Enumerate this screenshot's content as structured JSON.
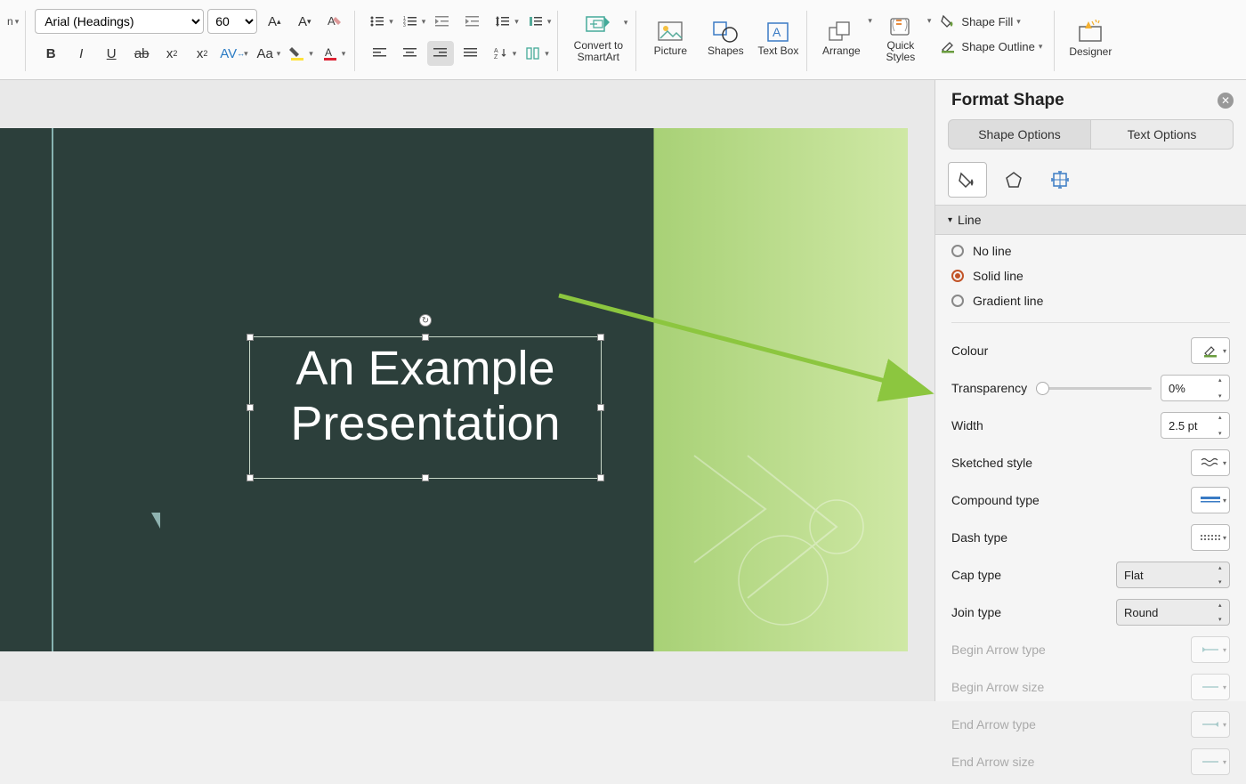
{
  "ribbon": {
    "font_name": "Arial (Headings)",
    "font_size": "60",
    "convert_smartart": "Convert to SmartArt",
    "picture": "Picture",
    "shapes": "Shapes",
    "textbox": "Text Box",
    "arrange": "Arrange",
    "quick_styles": "Quick Styles",
    "shape_fill": "Shape Fill",
    "shape_outline": "Shape Outline",
    "designer": "Designer"
  },
  "slide": {
    "title": "An Example Presentation"
  },
  "pane": {
    "title": "Format Shape",
    "tab_shape": "Shape Options",
    "tab_text": "Text Options",
    "section_line": "Line",
    "line_none": "No line",
    "line_solid": "Solid line",
    "line_gradient": "Gradient line",
    "colour": "Colour",
    "transparency": "Transparency",
    "transparency_val": "0%",
    "width": "Width",
    "width_val": "2.5 pt",
    "sketched": "Sketched style",
    "compound": "Compound type",
    "dash": "Dash type",
    "cap": "Cap type",
    "cap_val": "Flat",
    "join": "Join type",
    "join_val": "Round",
    "begin_arrow_type": "Begin Arrow type",
    "begin_arrow_size": "Begin Arrow size",
    "end_arrow_type": "End Arrow type",
    "end_arrow_size": "End Arrow size"
  }
}
